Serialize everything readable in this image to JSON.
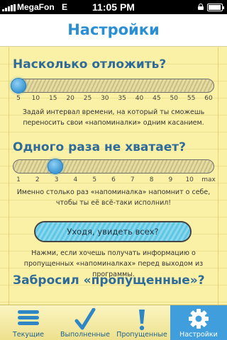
{
  "status_bar": {
    "carrier": "MegaFon",
    "network": "E",
    "time": "11:05 PM"
  },
  "nav": {
    "title": "Настройки"
  },
  "sections": [
    {
      "title": "Насколько отложить?",
      "ticks": [
        "5",
        "10",
        "15",
        "20",
        "25",
        "30",
        "35",
        "40",
        "45",
        "50",
        "55",
        "60"
      ],
      "selected": "5",
      "description": "Задай интервал времени, на который ты сможешь переносить свои «напоминалки» одним касанием."
    },
    {
      "title": "Одного раза не хватает?",
      "ticks": [
        "1",
        "2",
        "3",
        "4",
        "5",
        "6",
        "7",
        "8",
        "9",
        "10",
        "max"
      ],
      "selected": "3",
      "description": "Именно столько раз «напоминалка» напомнит о себе, чтобы ты её всё-таки исполнил!"
    },
    {
      "button_label": "Уходя, увидеть всех?",
      "description": "Нажми, если хочешь получать информацию о пропущенных «напоминалках» перед выходом из программы."
    },
    {
      "title": "Забросил «пропущенные»?"
    }
  ],
  "tabs": [
    {
      "label": "Текущие",
      "icon": "list-icon",
      "active": false
    },
    {
      "label": "Выполненные",
      "icon": "checkmark-icon",
      "active": false
    },
    {
      "label": "Пропущенные",
      "icon": "exclamation-icon",
      "active": false
    },
    {
      "label": "Настройки",
      "icon": "gear-icon",
      "active": true
    }
  ],
  "colors": {
    "accent": "#2a8ed4",
    "paper": "#fbf1a6",
    "section_title": "#2e6b9a",
    "slider_thumb": "#3d97d3",
    "tab_active": "#3f9edb"
  }
}
